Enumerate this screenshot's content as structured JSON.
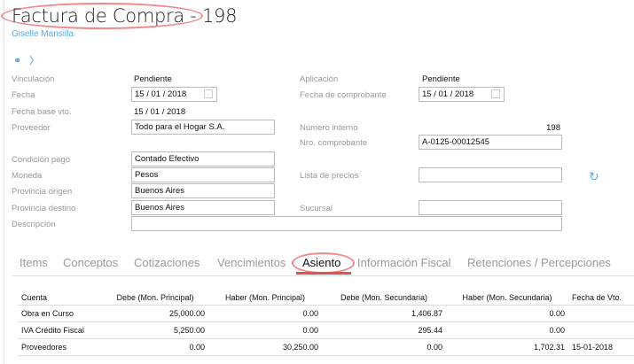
{
  "header": {
    "title": "Factura de Compra - 198",
    "user": "Giselle Mansilla"
  },
  "form": {
    "vinculacion_label": "Vinculación",
    "vinculacion_value": "Pendiente",
    "aplicacion_label": "Aplicación",
    "aplicacion_value": "Pendiente",
    "fecha_label": "Fecha",
    "fecha_value": "15 / 01 / 2018",
    "fecha_comprobante_label": "Fecha de comprobante",
    "fecha_comprobante_value": "15 / 01 / 2018",
    "fecha_base_label": "Fecha base vto.",
    "fecha_base_value": "15 / 01 / 2018",
    "proveedor_label": "Proveedor",
    "proveedor_value": "Todo para el Hogar S.A.",
    "numero_interno_label": "Número interno",
    "numero_interno_value": "198",
    "nro_comprobante_label": "Nro. comprobante",
    "nro_comprobante_value": "A-0125-00012545",
    "condicion_label": "Condición pago",
    "condicion_value": "Contado Efectivo",
    "moneda_label": "Moneda",
    "moneda_value": "Pesos",
    "lista_precios_label": "Lista de precios",
    "lista_precios_value": "",
    "prov_origen_label": "Provincia origen",
    "prov_origen_value": "Buenos Aires",
    "prov_destino_label": "Provincia destino",
    "prov_destino_value": "Buenos Aires",
    "sucursal_label": "Sucursal",
    "sucursal_value": "",
    "descripcion_label": "Descripción",
    "descripcion_value": ""
  },
  "tabs": [
    "Items",
    "Conceptos",
    "Cotizaciones",
    "Vencimientos",
    "Asiento",
    "Información Fiscal",
    "Retenciones / Percepciones"
  ],
  "table": {
    "headers": [
      "Cuenta",
      "Debe (Mon. Principal)",
      "Haber (Mon. Principal)",
      "Debe (Mon. Secundaria)",
      "Haber (Mon. Secundaria)",
      "Fecha de Vto."
    ],
    "rows": [
      [
        "Obra en Curso",
        "25,000.00",
        "0.00",
        "1,406.87",
        "0.00",
        ""
      ],
      [
        "IVA Crédito Fiscal",
        "5,250.00",
        "0.00",
        "295.44",
        "0.00",
        ""
      ],
      [
        "Proveedores",
        "0.00",
        "30,250.00",
        "0.00",
        "1,702.31",
        "15-01-2018"
      ]
    ]
  }
}
